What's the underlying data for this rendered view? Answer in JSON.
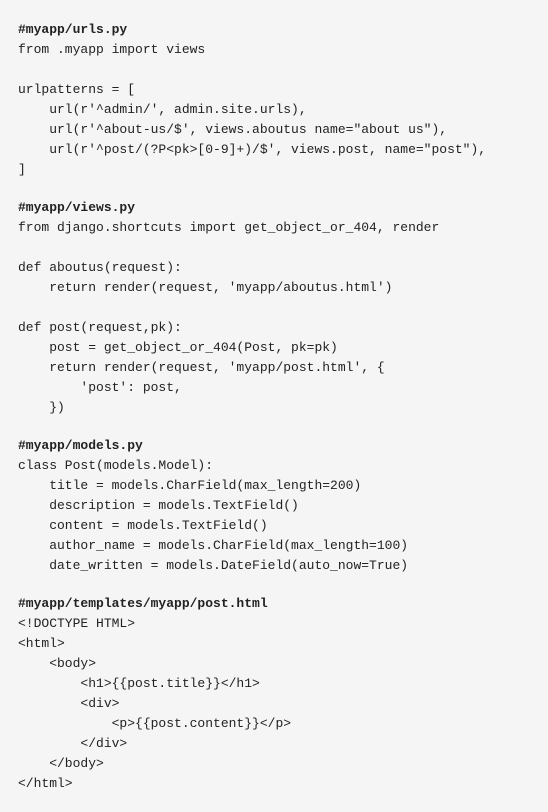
{
  "sections": [
    {
      "heading": "#myapp/urls.py",
      "code": "from .myapp import views\n\nurlpatterns = [\n    url(r'^admin/', admin.site.urls),\n    url(r'^about-us/$', views.aboutus name=\"about us\"),\n    url(r'^post/(?P<pk>[0-9]+)/$', views.post, name=\"post\"),\n]"
    },
    {
      "heading": "#myapp/views.py",
      "code": "from django.shortcuts import get_object_or_404, render\n\ndef aboutus(request):\n    return render(request, 'myapp/aboutus.html')\n\ndef post(request,pk):\n    post = get_object_or_404(Post, pk=pk)\n    return render(request, 'myapp/post.html', {\n        'post': post,\n    })"
    },
    {
      "heading": "#myapp/models.py",
      "code": "class Post(models.Model):\n    title = models.CharField(max_length=200)\n    description = models.TextField()\n    content = models.TextField()\n    author_name = models.CharField(max_length=100)\n    date_written = models.DateField(auto_now=True)"
    },
    {
      "heading": "#myapp/templates/myapp/post.html",
      "code": "<!DOCTYPE HTML>\n<html>\n    <body>\n        <h1>{{post.title}}</h1>\n        <div>\n            <p>{{post.content}}</p>\n        </div>\n    </body>\n</html>"
    }
  ]
}
